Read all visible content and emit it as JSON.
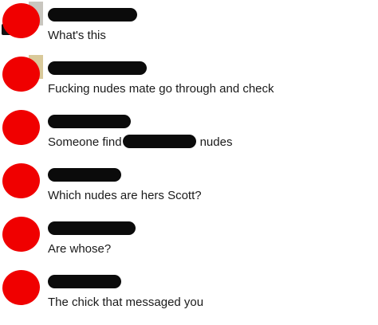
{
  "conversation": {
    "messages": [
      {
        "text": "What's this"
      },
      {
        "text": "Fucking nudes mate go through and check"
      },
      {
        "text_before": "Someone find",
        "text_after": "nudes"
      },
      {
        "text": "Which nudes are hers Scott?"
      },
      {
        "text": "Are whose?"
      },
      {
        "text": "The chick that messaged you"
      }
    ]
  },
  "colors": {
    "avatar_redaction": "#f00000",
    "name_redaction": "#0b0b0b",
    "background": "#ffffff",
    "message_text": "#1a1a1a"
  },
  "icons": {
    "avatar": "redacted-avatar"
  }
}
